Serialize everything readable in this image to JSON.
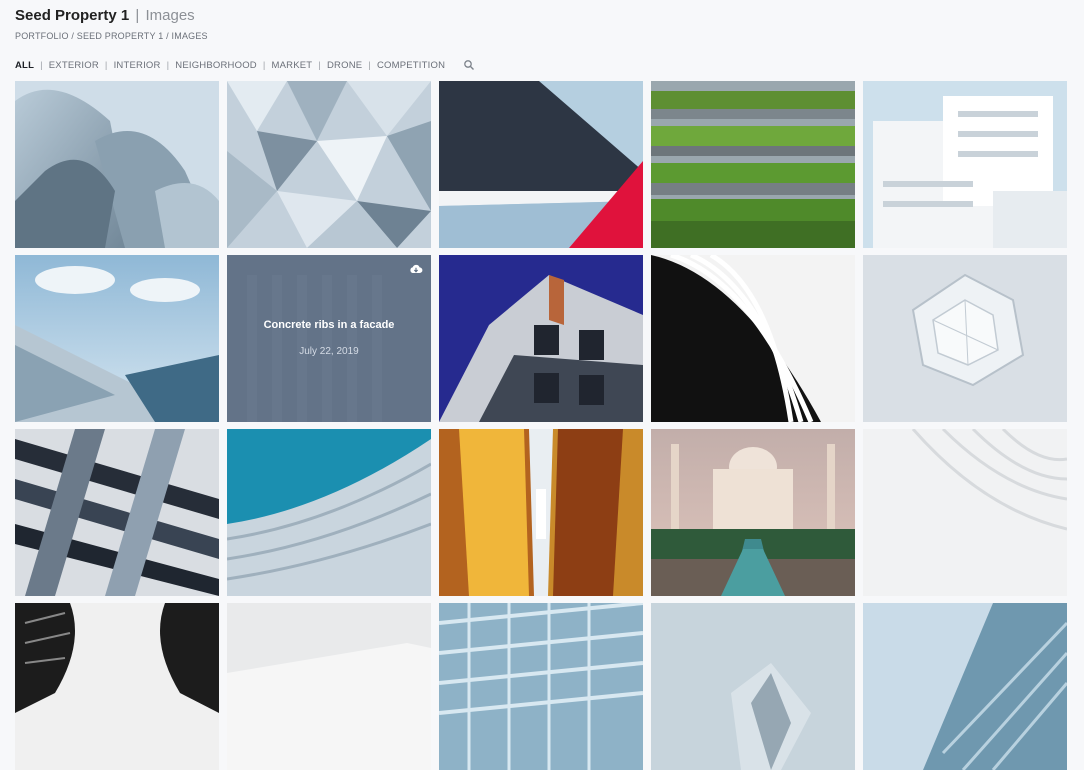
{
  "header": {
    "title": "Seed Property 1",
    "separator": "|",
    "subtitle": "Images",
    "breadcrumb": "PORTFOLIO / SEED PROPERTY 1 / IMAGES"
  },
  "filters": {
    "items": [
      "ALL",
      "EXTERIOR",
      "INTERIOR",
      "NEIGHBORHOOD",
      "MARKET",
      "DRONE",
      "COMPETITION"
    ],
    "active": "ALL",
    "divider": "|",
    "search_icon": "search-icon"
  },
  "gallery": {
    "hovered": {
      "caption": "Concrete ribs in a facade",
      "date": "July 22, 2019",
      "icon": "cloud-download-icon"
    }
  }
}
